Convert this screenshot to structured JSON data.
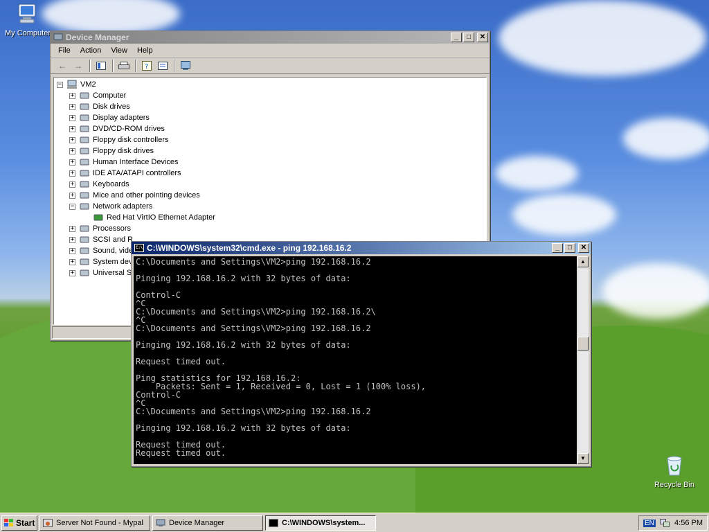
{
  "desktop": {
    "icons": [
      {
        "label": "My Computer"
      },
      {
        "label": "Recycle Bin"
      }
    ]
  },
  "device_manager": {
    "title": "Device Manager",
    "menu": [
      "File",
      "Action",
      "View",
      "Help"
    ],
    "tree": {
      "root": "VM2",
      "items": [
        {
          "label": "Computer",
          "expanded": false
        },
        {
          "label": "Disk drives",
          "expanded": false
        },
        {
          "label": "Display adapters",
          "expanded": false
        },
        {
          "label": "DVD/CD-ROM drives",
          "expanded": false
        },
        {
          "label": "Floppy disk controllers",
          "expanded": false
        },
        {
          "label": "Floppy disk drives",
          "expanded": false
        },
        {
          "label": "Human Interface Devices",
          "expanded": false
        },
        {
          "label": "IDE ATA/ATAPI controllers",
          "expanded": false
        },
        {
          "label": "Keyboards",
          "expanded": false
        },
        {
          "label": "Mice and other pointing devices",
          "expanded": false
        },
        {
          "label": "Network adapters",
          "expanded": true
        },
        {
          "label": "Red Hat VirtIO Ethernet Adapter",
          "child": true
        },
        {
          "label": "Processors",
          "expanded": false
        },
        {
          "label": "SCSI and R",
          "expanded": false
        },
        {
          "label": "Sound, vide",
          "expanded": false
        },
        {
          "label": "System dev",
          "expanded": false
        },
        {
          "label": "Universal S",
          "expanded": false
        }
      ]
    }
  },
  "cmd": {
    "title": "C:\\WINDOWS\\system32\\cmd.exe - ping 192.168.16.2",
    "lines": [
      "C:\\Documents and Settings\\VM2>ping 192.168.16.2",
      "",
      "Pinging 192.168.16.2 with 32 bytes of data:",
      "",
      "Control-C",
      "^C",
      "C:\\Documents and Settings\\VM2>ping 192.168.16.2\\",
      "^C",
      "C:\\Documents and Settings\\VM2>ping 192.168.16.2",
      "",
      "Pinging 192.168.16.2 with 32 bytes of data:",
      "",
      "Request timed out.",
      "",
      "Ping statistics for 192.168.16.2:",
      "    Packets: Sent = 1, Received = 0, Lost = 1 (100% loss),",
      "Control-C",
      "^C",
      "C:\\Documents and Settings\\VM2>ping 192.168.16.2",
      "",
      "Pinging 192.168.16.2 with 32 bytes of data:",
      "",
      "Request timed out.",
      "Request timed out."
    ]
  },
  "taskbar": {
    "start_label": "Start",
    "tasks": [
      {
        "label": "Server Not Found - Mypal",
        "active": false
      },
      {
        "label": "Device Manager",
        "active": false
      },
      {
        "label": "C:\\WINDOWS\\system...",
        "active": true
      }
    ],
    "tray": {
      "lang": "EN",
      "clock": "4:56 PM"
    }
  }
}
